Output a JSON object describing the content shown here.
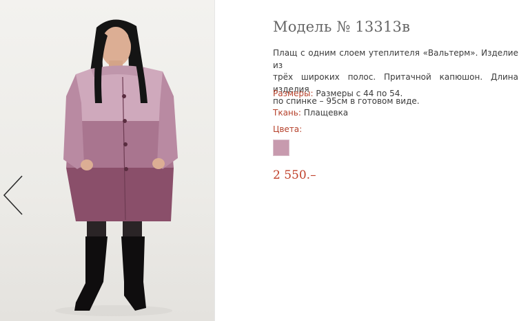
{
  "product": {
    "title": "Модель № 13313в",
    "description": "Плащ с одним слоем  утеплителя «Вальтерм». Изделие  из\nтрёх  широких полос. Притачной капюшон. Длина изделия\nпо спинке – 95см в готовом виде.",
    "sizes_label": "Размеры:",
    "sizes_value": " Размеры с 44 по 54.",
    "fabric_label": "Ткань:",
    "fabric_value": " Плащевка",
    "colors_label": "Цвета:",
    "color_swatches": [
      "#c79aae"
    ],
    "price": "2 550.–"
  },
  "gallery": {
    "prev_icon": "chevron-left-icon",
    "photo_subject": "woman wearing a three-tone mauve quilted coat with hood and black boots"
  }
}
